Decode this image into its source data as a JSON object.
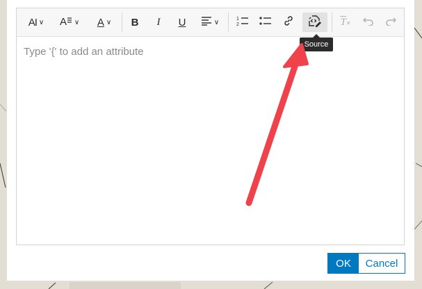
{
  "toolbar": {
    "font_size_label": "AI",
    "text_color_label": "A",
    "bold_label": "B",
    "italic_label": "I",
    "underline_label": "U",
    "clear_format_label": "T"
  },
  "editor": {
    "placeholder": "Type '{' to add an attribute"
  },
  "tooltip": {
    "text": "Source"
  },
  "footer": {
    "ok_label": "OK",
    "cancel_label": "Cancel"
  },
  "colors": {
    "accent": "#0079c1",
    "annotation_arrow": "#f0424b"
  }
}
